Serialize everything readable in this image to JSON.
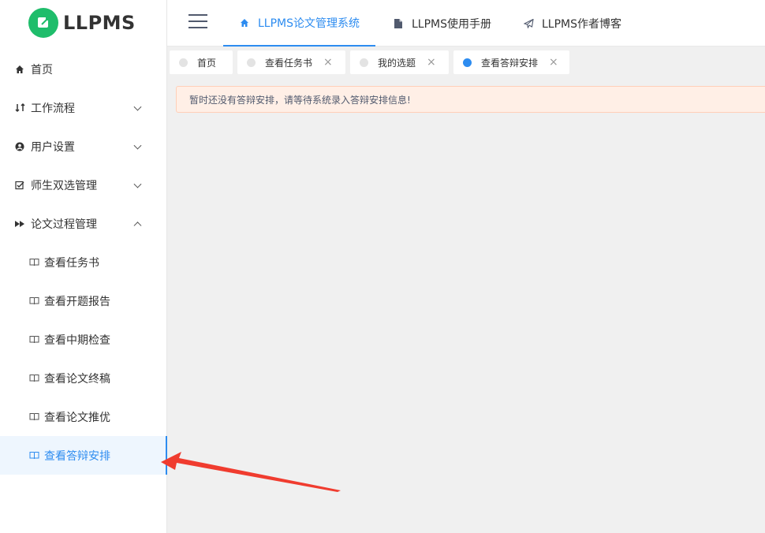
{
  "app": {
    "logo_text": "LLPMS",
    "brand_color": "#1fbd6b",
    "accent_color": "#2d8cf0"
  },
  "topnav": {
    "menu_icon": "hamburger-icon",
    "tabs": [
      {
        "label": "LLPMS论文管理系统",
        "icon": "home-icon",
        "active": true
      },
      {
        "label": "LLPMS使用手册",
        "icon": "document-icon",
        "active": false
      },
      {
        "label": "LLPMS作者博客",
        "icon": "paper-plane-icon",
        "active": false
      }
    ]
  },
  "sidebar": {
    "items": [
      {
        "label": "首页",
        "icon": "home-icon"
      },
      {
        "label": "工作流程",
        "icon": "workflow-icon",
        "expanded": false
      },
      {
        "label": "用户设置",
        "icon": "user-circle-icon",
        "expanded": false
      },
      {
        "label": "师生双选管理",
        "icon": "checkbox-icon",
        "expanded": false
      },
      {
        "label": "论文过程管理",
        "icon": "fast-forward-icon",
        "expanded": true
      }
    ],
    "sub_items": [
      {
        "label": "查看任务书",
        "icon": "book-icon",
        "active": false
      },
      {
        "label": "查看开题报告",
        "icon": "book-icon",
        "active": false
      },
      {
        "label": "查看中期检查",
        "icon": "book-icon",
        "active": false
      },
      {
        "label": "查看论文终稿",
        "icon": "book-icon",
        "active": false
      },
      {
        "label": "查看论文推优",
        "icon": "book-icon",
        "active": false
      },
      {
        "label": "查看答辩安排",
        "icon": "book-icon",
        "active": true
      }
    ]
  },
  "tags": [
    {
      "label": "首页",
      "closable": false,
      "active": false
    },
    {
      "label": "查看任务书",
      "closable": true,
      "active": false
    },
    {
      "label": "我的选题",
      "closable": true,
      "active": false
    },
    {
      "label": "查看答辩安排",
      "closable": true,
      "active": true
    }
  ],
  "alert": {
    "text": "暂时还没有答辩安排，请等待系统录入答辩安排信息!",
    "color": "#ffefe6"
  },
  "annotation": {
    "arrow_color": "#f03c2f"
  }
}
